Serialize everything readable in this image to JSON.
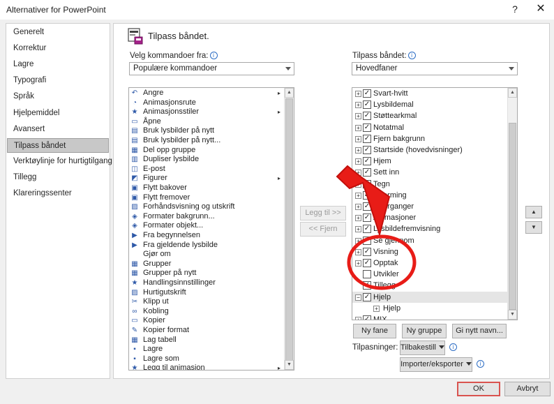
{
  "window": {
    "title": "Alternativer for PowerPoint",
    "help": "?",
    "close": "✕"
  },
  "nav": {
    "items": [
      {
        "label": "Generelt",
        "active": false
      },
      {
        "label": "Korrektur",
        "active": false
      },
      {
        "label": "Lagre",
        "active": false
      },
      {
        "label": "Typografi",
        "active": false
      },
      {
        "label": "Språk",
        "active": false
      },
      {
        "label": "Hjelpemiddel",
        "active": false
      },
      {
        "label": "Avansert",
        "active": false
      },
      {
        "label": "Tilpass båndet",
        "active": true
      },
      {
        "label": "Verktøylinje for hurtigtilgang",
        "active": false
      },
      {
        "label": "Tillegg",
        "active": false
      },
      {
        "label": "Klareringssenter",
        "active": false
      }
    ]
  },
  "main": {
    "heading": "Tilpass båndet.",
    "commands_from_label": "Velg kommandoer fra:",
    "commands_from_value": "Populære kommandoer",
    "customize_label": "Tilpass båndet:",
    "customize_value": "Hovedfaner",
    "commands": [
      {
        "label": "Angre",
        "icon": "↶",
        "sub": "▸"
      },
      {
        "label": "Animasjonsrute",
        "icon": "◔",
        "sub": ""
      },
      {
        "label": "Animasjonsstiler",
        "icon": "★",
        "sub": "▸"
      },
      {
        "label": "Åpne",
        "icon": "▭",
        "sub": ""
      },
      {
        "label": "Bruk lysbilder på nytt",
        "icon": "▤",
        "sub": ""
      },
      {
        "label": "Bruk lysbilder på nytt...",
        "icon": "▤",
        "sub": ""
      },
      {
        "label": "Del opp gruppe",
        "icon": "▦",
        "sub": ""
      },
      {
        "label": "Dupliser lysbilde",
        "icon": "▥",
        "sub": ""
      },
      {
        "label": "E-post",
        "icon": "◫",
        "sub": ""
      },
      {
        "label": "Figurer",
        "icon": "◩",
        "sub": "▸"
      },
      {
        "label": "Flytt bakover",
        "icon": "▣",
        "sub": ""
      },
      {
        "label": "Flytt fremover",
        "icon": "▣",
        "sub": ""
      },
      {
        "label": "Forhåndsvisning og utskrift",
        "icon": "▨",
        "sub": ""
      },
      {
        "label": "Formater bakgrunn...",
        "icon": "◈",
        "sub": ""
      },
      {
        "label": "Formater objekt...",
        "icon": "◈",
        "sub": ""
      },
      {
        "label": "Fra begynnelsen",
        "icon": "▶",
        "sub": ""
      },
      {
        "label": "Fra gjeldende lysbilde",
        "icon": "▶",
        "sub": ""
      },
      {
        "label": "Gjør om",
        "icon": "",
        "sub": ""
      },
      {
        "label": "Grupper",
        "icon": "▦",
        "sub": ""
      },
      {
        "label": "Grupper på nytt",
        "icon": "▦",
        "sub": ""
      },
      {
        "label": "Handlingsinnstillinger",
        "icon": "★",
        "sub": ""
      },
      {
        "label": "Hurtigutskrift",
        "icon": "▨",
        "sub": ""
      },
      {
        "label": "Klipp ut",
        "icon": "✂",
        "sub": ""
      },
      {
        "label": "Kobling",
        "icon": "∞",
        "sub": ""
      },
      {
        "label": "Kopier",
        "icon": "▭",
        "sub": ""
      },
      {
        "label": "Kopier format",
        "icon": "✎",
        "sub": ""
      },
      {
        "label": "Lag tabell",
        "icon": "▦",
        "sub": ""
      },
      {
        "label": "Lagre",
        "icon": "▪",
        "sub": ""
      },
      {
        "label": "Lagre som",
        "icon": "▪",
        "sub": ""
      },
      {
        "label": "Legg til animasjon",
        "icon": "★",
        "sub": "▸"
      }
    ],
    "tabs": [
      {
        "label": "Svart-hvitt",
        "expander": "+",
        "checked": true,
        "level": 0,
        "selected": false
      },
      {
        "label": "Lysbildemal",
        "expander": "+",
        "checked": true,
        "level": 0,
        "selected": false
      },
      {
        "label": "Støttearkmal",
        "expander": "+",
        "checked": true,
        "level": 0,
        "selected": false
      },
      {
        "label": "Notatmal",
        "expander": "+",
        "checked": true,
        "level": 0,
        "selected": false
      },
      {
        "label": "Fjern bakgrunn",
        "expander": "+",
        "checked": true,
        "level": 0,
        "selected": false
      },
      {
        "label": "Startside (hovedvisninger)",
        "expander": "+",
        "checked": true,
        "level": 0,
        "selected": false
      },
      {
        "label": "Hjem",
        "expander": "+",
        "checked": true,
        "level": 0,
        "selected": false
      },
      {
        "label": "Sett inn",
        "expander": "+",
        "checked": true,
        "level": 0,
        "selected": false
      },
      {
        "label": "Tegn",
        "expander": "+",
        "checked": true,
        "level": 0,
        "selected": false
      },
      {
        "label": "Utforming",
        "expander": "+",
        "checked": true,
        "level": 0,
        "selected": false
      },
      {
        "label": "Overganger",
        "expander": "+",
        "checked": true,
        "level": 0,
        "selected": false
      },
      {
        "label": "Animasjoner",
        "expander": "+",
        "checked": true,
        "level": 0,
        "selected": false
      },
      {
        "label": "Lysbildefremvisning",
        "expander": "+",
        "checked": true,
        "level": 0,
        "selected": false
      },
      {
        "label": "Se gjennom",
        "expander": "+",
        "checked": true,
        "level": 0,
        "selected": false
      },
      {
        "label": "Visning",
        "expander": "+",
        "checked": true,
        "level": 0,
        "selected": false
      },
      {
        "label": "Opptak",
        "expander": "+",
        "checked": true,
        "level": 0,
        "selected": false
      },
      {
        "label": "Utvikler",
        "expander": "",
        "checked": false,
        "level": 0,
        "selected": false
      },
      {
        "label": "Tillegg",
        "expander": "",
        "checked": true,
        "level": 0,
        "selected": false
      },
      {
        "label": "Hjelp",
        "expander": "−",
        "checked": true,
        "level": 0,
        "selected": true
      },
      {
        "label": "Hjelp",
        "expander": "+",
        "checked": null,
        "level": 1,
        "selected": false
      },
      {
        "label": "MIX",
        "expander": "+",
        "checked": true,
        "level": 0,
        "selected": false
      }
    ],
    "add_button": "Legg til >>",
    "remove_button": "<< Fjern",
    "new_tab_button": "Ny fane",
    "new_group_button": "Ny gruppe",
    "rename_button": "Gi nytt navn...",
    "customizations_label": "Tilpasninger:",
    "reset_button": "Tilbakestill",
    "import_export_button": "Importer/eksporter",
    "move_up": "▲",
    "move_down": "▼"
  },
  "footer": {
    "ok": "OK",
    "cancel": "Avbryt"
  },
  "annotation": {
    "arrow_color": "#e81c17",
    "circle_color": "#e81c17"
  }
}
